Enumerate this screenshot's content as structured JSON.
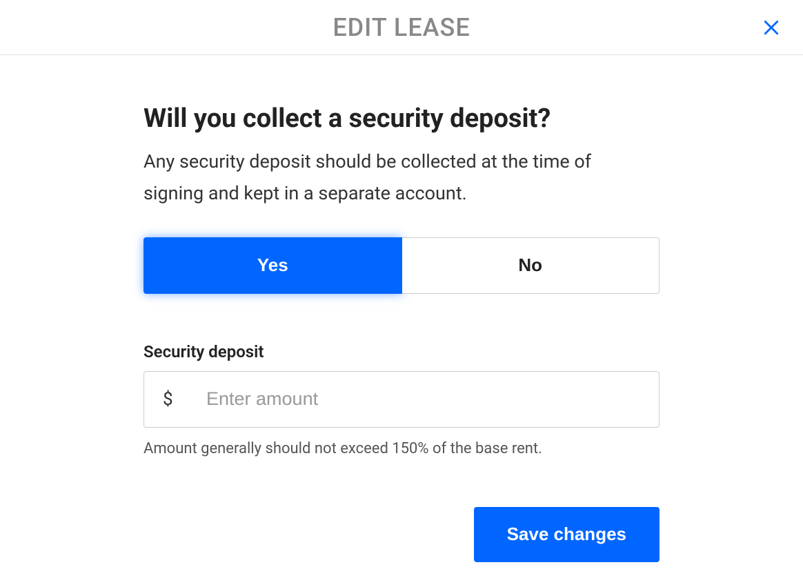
{
  "header": {
    "title": "EDIT LEASE"
  },
  "main": {
    "question": "Will you collect a security deposit?",
    "description": "Any security deposit should be collected at the time of signing and kept in a separate account.",
    "toggle": {
      "yes_label": "Yes",
      "no_label": "No",
      "selected": "yes"
    },
    "deposit_field": {
      "label": "Security deposit",
      "currency_symbol": "$",
      "placeholder": "Enter amount",
      "value": "",
      "helper_text": "Amount generally should not exceed 150% of the base rent."
    },
    "actions": {
      "save_label": "Save changes"
    }
  },
  "colors": {
    "accent": "#0066ff",
    "text_primary": "#222222",
    "text_secondary": "#555555",
    "header_text": "#888888",
    "border": "#cccccc"
  }
}
